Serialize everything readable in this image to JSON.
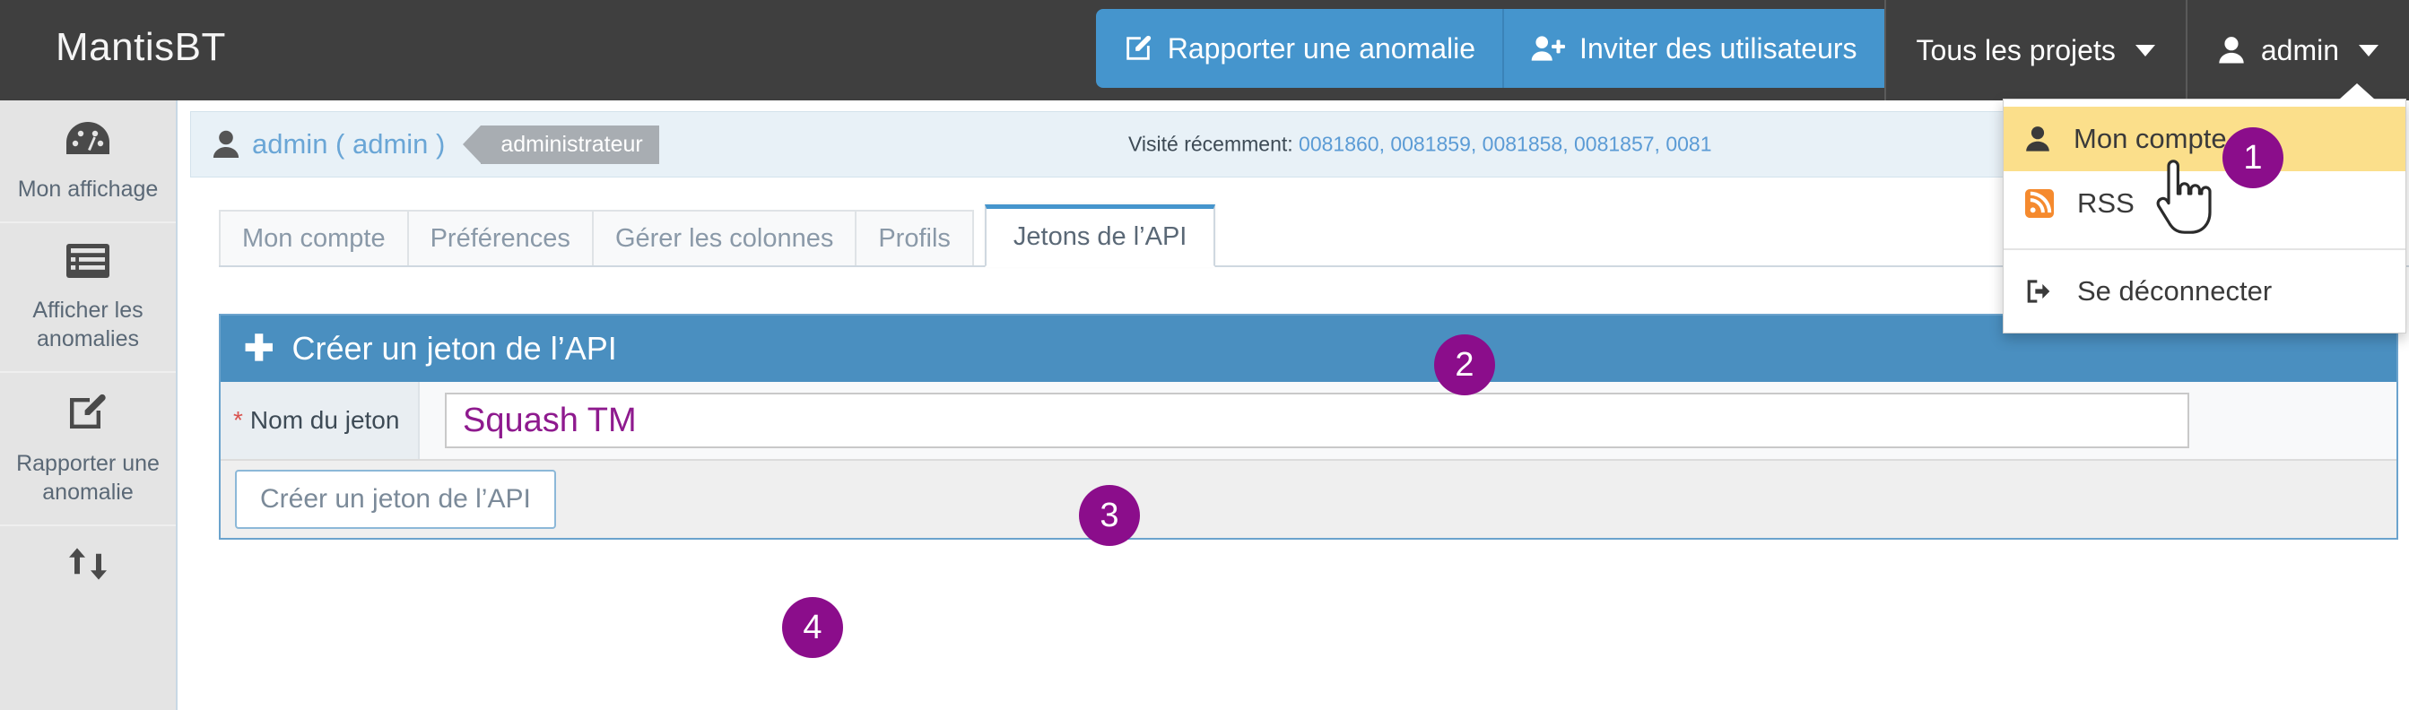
{
  "navbar": {
    "brand": "MantisBT",
    "buttons": [
      {
        "label": "Rapporter une anomalie",
        "icon": "edit-square-icon"
      },
      {
        "label": "Inviter des utilisateurs",
        "icon": "user-plus-icon"
      }
    ],
    "project_selector": {
      "label": "Tous les projets",
      "icon": "chevron-down-icon"
    },
    "user_menu": {
      "label": "admin",
      "icon": "user-icon"
    }
  },
  "user_dropdown": {
    "items": [
      {
        "label": "Mon compte",
        "icon": "user-icon",
        "highlighted": true
      },
      {
        "label": "RSS",
        "icon": "rss-icon",
        "highlighted": false
      },
      {
        "label": "Se déconnecter",
        "icon": "sign-out-icon",
        "highlighted": false
      }
    ]
  },
  "sidebar": {
    "items": [
      {
        "label": "Mon affichage",
        "icon": "dashboard-gauge-icon"
      },
      {
        "label": "Afficher les anomalies",
        "icon": "list-view-icon"
      },
      {
        "label": "Rapporter une anomalie",
        "icon": "edit-square-icon"
      },
      {
        "label": "",
        "icon": "transfer-arrows-icon"
      }
    ]
  },
  "userbar": {
    "user": "admin ( admin )",
    "role": "administrateur",
    "visited_label": "Visité récemment:",
    "visited_ids": "0081860, 0081859, 0081858, 0081857, 0081"
  },
  "tabs": [
    {
      "label": "Mon compte",
      "active": false
    },
    {
      "label": "Préférences",
      "active": false
    },
    {
      "label": "Gérer les colonnes",
      "active": false
    },
    {
      "label": "Profils",
      "active": false
    },
    {
      "label": "Jetons de l’API",
      "active": true
    }
  ],
  "panel": {
    "title": "Créer un jeton de l’API",
    "plus_icon": "plus-icon",
    "field": {
      "label": "Nom du jeton",
      "required_marker": "*",
      "value": "Squash TM",
      "placeholder": ""
    },
    "submit_label": "Créer un jeton de l’API"
  },
  "markers": {
    "m1": "1",
    "m2": "2",
    "m3": "3",
    "m4": "4",
    "color": "#8b0d8b"
  },
  "colors": {
    "navbar_bg": "#3f3f3f",
    "primary_blue": "#4595cd",
    "panel_header": "#4a8fc0",
    "highlight_yellow": "#fbdf8b",
    "input_text": "#8e1a8e",
    "rss_orange": "#f58a2e"
  }
}
